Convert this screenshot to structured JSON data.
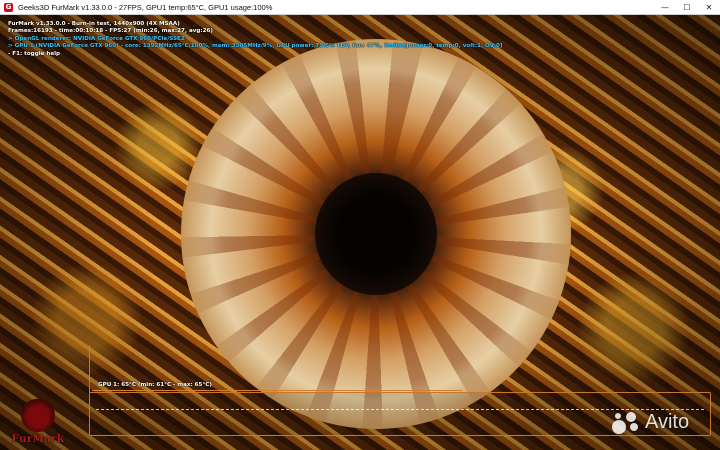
{
  "window": {
    "app_icon_letter": "G",
    "title": "Geeks3D FurMark v1.33.0.0 - 27FPS, GPU1 temp:65°C, GPU1 usage:100%",
    "minimize": "—",
    "maximize": "☐",
    "close": "✕"
  },
  "osd": {
    "lines": [
      "FurMark v1.33.0.0 - Burn-in test, 1440x900 (4X MSAA)",
      "Frames:16193 - time:00:10:18 - FPS:27 (min:26, max:27, avg:26)",
      "> OpenGL renderer: NVIDIA GeForce GTX 960/PCIe/SSE2",
      "> GPU 1 (NVIDIA GeForce GTX 960) - core: 1392MHz/65°C/100%, mem: 3505MHz/9%, GPU power: 79.5% TDP, fan: 47%, limits:[power:0, temp:0, volt:1, OV:0]",
      "- F1: toggle help"
    ]
  },
  "graph": {
    "label": "GPU 1: 65°C (min: 61°C - max: 65°C)",
    "current": 65,
    "min": 61,
    "max": 65,
    "line_color": "#c8782a"
  },
  "logo": {
    "text": "FurMark"
  },
  "watermark": {
    "text": "Avito"
  }
}
